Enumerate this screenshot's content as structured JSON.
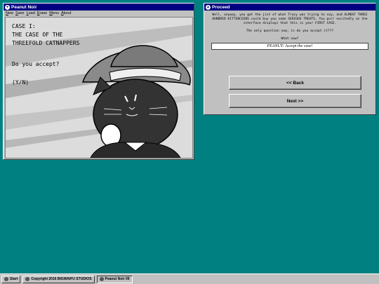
{
  "game_window": {
    "title": "Peanut Noir",
    "menu": [
      "New",
      "Save",
      "Load",
      "Erase",
      "Menu",
      "About"
    ],
    "case_label": "CASE I:",
    "case_title_line1": "THE CASE OF THE",
    "case_title_line2": "THREEFOLD CATNAPPERS",
    "accept_question": "Do you accept?",
    "yn_prompt": "(Y/N)"
  },
  "proceed_window": {
    "title": "Proceed",
    "narration": "Well, anyway, you got the jist of what Tracy was trying to say, and ALMOST THREE HUNDRED KITTENCOINS could buy you some SERIOUS TREATS. You purr excitedly as the interface displays that this is your FIRST CASE.",
    "question": "The only question now, is do you accept it???",
    "prompt": "What now?",
    "answer": "PEANUT: Accept the case!",
    "back_label": "<< Back",
    "next_label": "Next >>"
  },
  "taskbar": {
    "start_label": "Start",
    "copyright": "Copyright 2016 BIGWAIFU STUDIOS",
    "task_label": "Peanut Noir 09"
  }
}
